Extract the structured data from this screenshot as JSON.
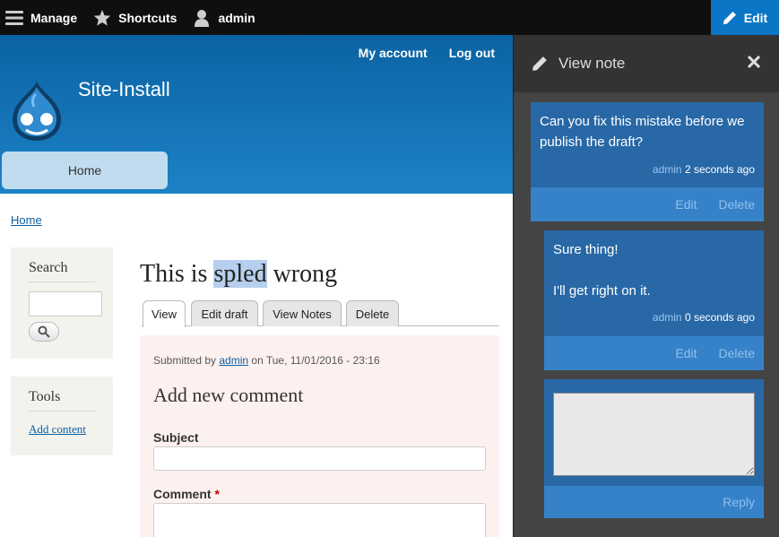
{
  "toolbar": {
    "manage_label": "Manage",
    "shortcuts_label": "Shortcuts",
    "user_label": "admin",
    "edit_label": "Edit"
  },
  "header": {
    "secondary_menu": [
      "My account",
      "Log out"
    ],
    "site_name": "Site-Install",
    "primary_menu": [
      "Home"
    ]
  },
  "breadcrumb": [
    "Home"
  ],
  "sidebar": {
    "search": {
      "title": "Search",
      "input_value": ""
    },
    "tools": {
      "title": "Tools",
      "links": [
        "Add content"
      ]
    }
  },
  "main": {
    "title_before": "This is ",
    "title_highlight": "spled",
    "title_after": " wrong",
    "tabs": [
      "View",
      "Edit draft",
      "View Notes",
      "Delete"
    ],
    "active_tab": "View",
    "submitted_prefix": "Submitted by ",
    "submitted_author": "admin",
    "submitted_suffix": " on Tue, 11/01/2016 - 23:16",
    "comment_form": {
      "heading": "Add new comment",
      "subject_label": "Subject",
      "subject_value": "",
      "comment_label": "Comment",
      "required_marker": "*"
    }
  },
  "panel": {
    "title": "View note",
    "notes": [
      {
        "text": "Can you fix this mistake before we publish the draft?",
        "author": "admin",
        "time": "2 seconds ago",
        "edit_label": "Edit",
        "delete_label": "Delete"
      },
      {
        "text_line1": "Sure thing!",
        "text_line2": "I'll get right on it.",
        "author": "admin",
        "time": "0 seconds ago",
        "edit_label": "Edit",
        "delete_label": "Delete"
      }
    ],
    "reply": {
      "value": "",
      "button_label": "Reply"
    }
  },
  "colors": {
    "toolbar_bg": "#0f0f0f",
    "edit_bg": "#0b76c5",
    "header_top": "#0b63a3",
    "header_bottom": "#1c82c6",
    "note_bg": "#2868a6",
    "note_actions_bg": "#3682c8",
    "panel_bg": "#444444"
  }
}
